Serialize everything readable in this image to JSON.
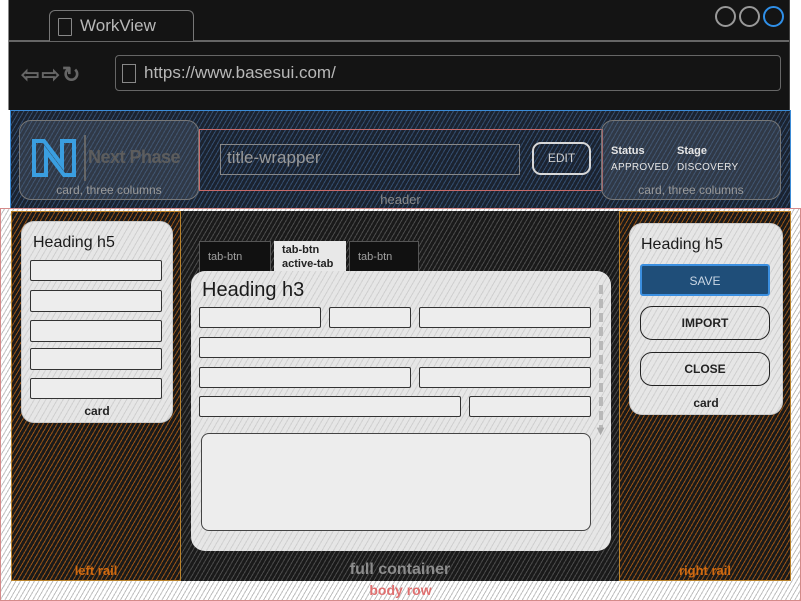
{
  "browser": {
    "tab_title": "WorkView",
    "url": "https://www.basesui.com/",
    "nav_icons": [
      "back-arrow-icon",
      "forward-arrow-icon",
      "refresh-icon"
    ],
    "window_controls": [
      "circle-gray",
      "circle-gray",
      "circle-blue"
    ],
    "accent": "#2f8fe8"
  },
  "header": {
    "label": "header",
    "brand_card": {
      "logo_text": "Next Phase",
      "caption": "card, three columns",
      "logo_color": "#3a9ee0"
    },
    "title_wrapper": {
      "input_value": "title-wrapper",
      "edit_label": "EDIT"
    },
    "status_card": {
      "status_label": "Status",
      "status_value": "APPROVED",
      "stage_label": "Stage",
      "stage_value": "DISCOVERY",
      "caption": "card, three columns"
    }
  },
  "body_row": {
    "label": "body row",
    "left_rail": {
      "label": "left rail",
      "card": {
        "heading": "Heading h5",
        "caption": "card",
        "field_count": 5
      }
    },
    "center": {
      "label": "full container",
      "tabs": [
        {
          "label": "tab-btn",
          "active": false
        },
        {
          "label": "tab-btn",
          "sublabel": "active-tab",
          "active": true
        },
        {
          "label": "tab-btn",
          "active": false
        }
      ],
      "heading": "Heading h3"
    },
    "right_rail": {
      "label": "right rail",
      "card": {
        "heading": "Heading h5",
        "caption": "card",
        "buttons": [
          {
            "label": "SAVE",
            "primary": true
          },
          {
            "label": "IMPORT",
            "primary": false
          },
          {
            "label": "CLOSE",
            "primary": false
          }
        ]
      }
    }
  },
  "colors": {
    "primary_button": "#1f4e79",
    "rail_border": "#b9822a",
    "rail_label": "#d06a10",
    "header_border": "#3b8bd6",
    "body_row_label": "#e07070"
  }
}
